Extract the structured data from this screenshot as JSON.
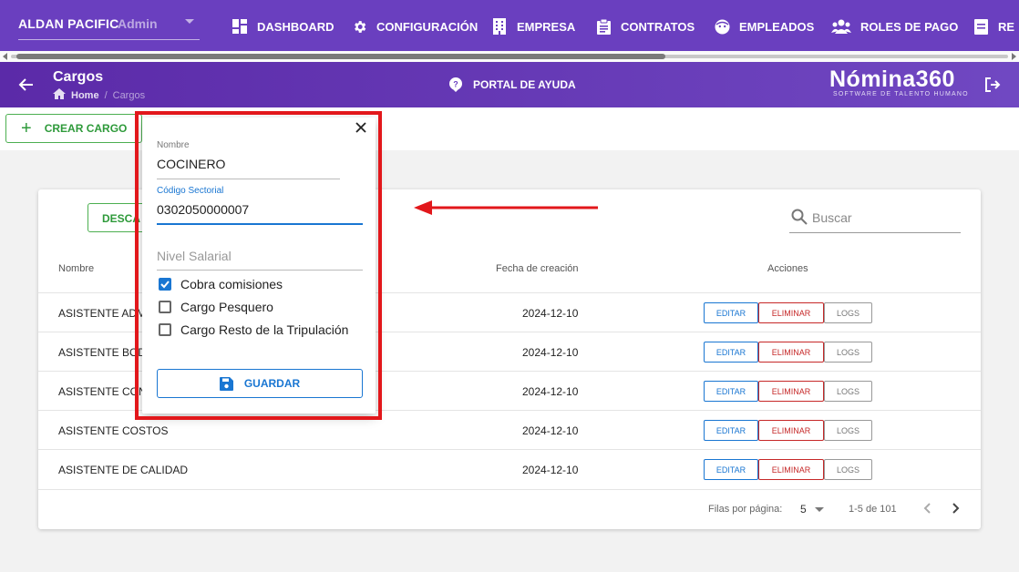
{
  "topbar": {
    "company": "ALDAN PACIFIC",
    "role": "Admin",
    "nav": [
      {
        "label": "DASHBOARD",
        "icon": "dashboard-icon"
      },
      {
        "label": "CONFIGURACIÓN",
        "icon": "gear-icon"
      },
      {
        "label": "EMPRESA",
        "icon": "building-icon"
      },
      {
        "label": "CONTRATOS",
        "icon": "clipboard-icon"
      },
      {
        "label": "EMPLEADOS",
        "icon": "face-icon"
      },
      {
        "label": "ROLES DE PAGO",
        "icon": "people-icon"
      },
      {
        "label": "RE",
        "icon": "report-icon"
      }
    ]
  },
  "header": {
    "title": "Cargos",
    "breadcrumb": {
      "home": "Home",
      "separator": "/",
      "current": "Cargos"
    },
    "help": "PORTAL DE AYUDA",
    "brand": "Nómina360",
    "brand_tagline": "SOFTWARE DE TALENTO HUMANO"
  },
  "toolbar": {
    "create": "CREAR CARGO"
  },
  "table": {
    "download_button": "DESCA",
    "search_placeholder": "Buscar",
    "columns": {
      "name": "Nombre",
      "date": "Fecha de creación",
      "actions": "Acciones"
    },
    "rows": [
      {
        "name": "ASISTENTE ADM",
        "date": "2024-12-10"
      },
      {
        "name": "ASISTENTE BOD",
        "date": "2024-12-10"
      },
      {
        "name": "ASISTENTE CON",
        "date": "2024-12-10"
      },
      {
        "name": "ASISTENTE COSTOS",
        "date": "2024-12-10"
      },
      {
        "name": "ASISTENTE DE CALIDAD",
        "date": "2024-12-10"
      }
    ],
    "actions": {
      "edit": "EDITAR",
      "delete": "ELIMINAR",
      "logs": "LOGS"
    },
    "footer": {
      "rows_per_page_label": "Filas por página:",
      "rows_per_page": "5",
      "range": "1-5 de 101"
    }
  },
  "dialog": {
    "name_label": "Nombre",
    "name_value": "COCINERO",
    "code_label": "Código Sectorial",
    "code_value": "0302050000007",
    "level_placeholder": "Nivel Salarial",
    "checkboxes": [
      {
        "label": "Cobra comisiones",
        "checked": true
      },
      {
        "label": "Cargo Pesquero",
        "checked": false
      },
      {
        "label": "Cargo Resto de la Tripulación",
        "checked": false
      }
    ],
    "save": "GUARDAR"
  },
  "colors": {
    "primary": "#6a3fbf",
    "accent_blue": "#1976d2",
    "green": "#4caf50",
    "danger": "#c62828",
    "highlight": "#e2171b"
  }
}
